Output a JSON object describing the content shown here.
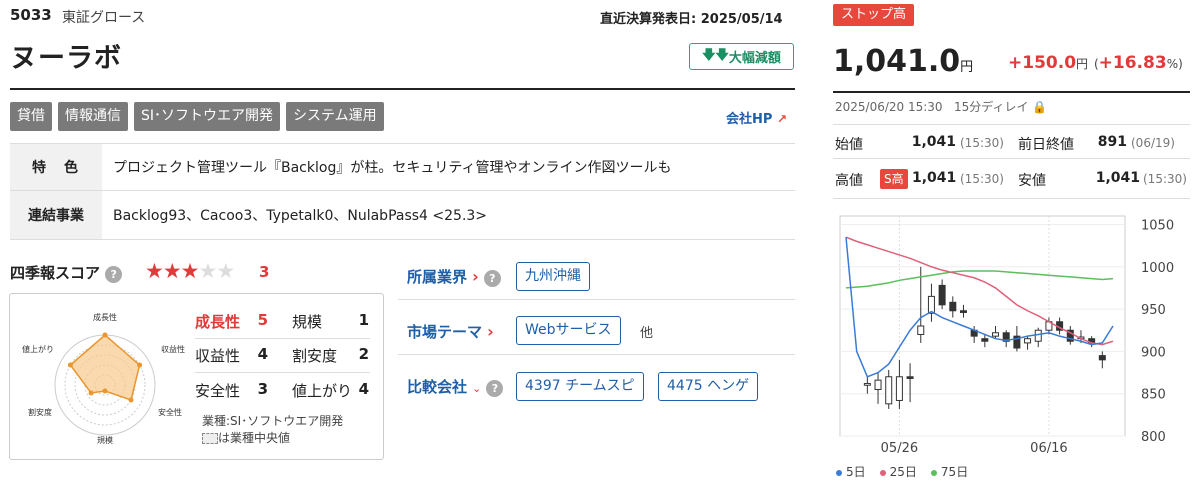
{
  "header": {
    "code": "5033",
    "market": "東証グロース",
    "kessan": "直近決算発表日: 2025/05/14",
    "name": "ヌーラボ",
    "badge": "大幅減額"
  },
  "tags": [
    "貸借",
    "情報通信",
    "SI･ソフトウエア開発",
    "システム運用"
  ],
  "hp_label": "会社HP",
  "feature": {
    "label": "特　色",
    "text": "プロジェクト管理ツール『Backlog』が柱。セキュリティ管理やオンライン作図ツールも"
  },
  "consolidated": {
    "label": "連結事業",
    "text": "Backlog93、Cacoo3、Typetalk0、NulabPass4 <25.3>"
  },
  "score": {
    "title": "四季報スコア",
    "value": "3",
    "stars_filled": 3,
    "stars_total": 5,
    "radar_labels": [
      "成長性",
      "収益性",
      "安全性",
      "規模",
      "割安度",
      "値上がり"
    ],
    "items": [
      {
        "label": "成長性",
        "value": "5",
        "highlight": true
      },
      {
        "label": "規模",
        "value": "1"
      },
      {
        "label": "収益性",
        "value": "4"
      },
      {
        "label": "割安度",
        "value": "2"
      },
      {
        "label": "安全性",
        "value": "3"
      },
      {
        "label": "値上がり",
        "value": "4"
      }
    ],
    "note1": "業種:SI･ソフトウエア開発",
    "note2": "は業種中央値"
  },
  "industry": {
    "label": "所属業界",
    "chip": "九州沖縄",
    "theme_label": "市場テーマ",
    "theme_chip": "Webサービス",
    "theme_more": "他",
    "compare_label": "比較会社",
    "compare_chips": [
      "4397 チームスピ",
      "4475 ヘンゲ"
    ]
  },
  "quote": {
    "stop": "ストップ高",
    "price": "1,041.0",
    "yen": "円",
    "change": "+150.0",
    "change_pct": "+16.83",
    "time": "2025/06/20 15:30",
    "delay": "15分ディレイ",
    "open_label": "始値",
    "open": "1,041",
    "open_time": "(15:30)",
    "prev_label": "前日終値",
    "prev": "891",
    "prev_time": "(06/19)",
    "high_label": "高値",
    "high_badge": "S高",
    "high": "1,041",
    "high_time": "(15:30)",
    "low_label": "安値",
    "low": "1,041",
    "low_time": "(15:30)"
  },
  "colors": {
    "up": "#e03a3a",
    "link": "#1e5fa8",
    "ma5": "#3a7bd5",
    "ma25": "#e0607a",
    "ma75": "#5bbf5b"
  },
  "chart_data": {
    "type": "line",
    "x_ticks": [
      "05/26",
      "06/16"
    ],
    "y_ticks": [
      800,
      850,
      900,
      950,
      1000,
      1050
    ],
    "ylim": [
      800,
      1060
    ],
    "legend": [
      "5日",
      "25日",
      "75日"
    ],
    "ma5": [
      1035,
      900,
      870,
      875,
      885,
      905,
      925,
      940,
      947,
      940,
      935,
      930,
      925,
      920,
      915,
      913,
      915,
      918,
      920,
      922,
      918,
      915,
      912,
      908,
      910,
      930
    ],
    "ma25": [
      1035,
      1030,
      1026,
      1022,
      1018,
      1014,
      1010,
      1005,
      1000,
      996,
      993,
      990,
      987,
      982,
      975,
      965,
      955,
      948,
      942,
      935,
      928,
      922,
      915,
      910,
      908,
      912
    ],
    "ma75": [
      975,
      976,
      977,
      979,
      981,
      984,
      986,
      988,
      990,
      992,
      994,
      995,
      995,
      995,
      995,
      994,
      993,
      992,
      991,
      990,
      989,
      988,
      987,
      986,
      985,
      986
    ],
    "candles": [
      {
        "o": 860,
        "c": 862,
        "h": 870,
        "l": 850
      },
      {
        "o": 855,
        "c": 866,
        "h": 875,
        "l": 838
      },
      {
        "o": 838,
        "c": 870,
        "h": 878,
        "l": 832
      },
      {
        "o": 842,
        "c": 870,
        "h": 890,
        "l": 832
      },
      {
        "o": 870,
        "c": 868,
        "h": 886,
        "l": 840
      },
      {
        "o": 920,
        "c": 930,
        "h": 1000,
        "l": 910
      },
      {
        "o": 945,
        "c": 965,
        "h": 980,
        "l": 935
      },
      {
        "o": 978,
        "c": 955,
        "h": 985,
        "l": 950
      },
      {
        "o": 958,
        "c": 948,
        "h": 965,
        "l": 940
      },
      {
        "o": 948,
        "c": 946,
        "h": 955,
        "l": 940
      },
      {
        "o": 925,
        "c": 918,
        "h": 930,
        "l": 910
      },
      {
        "o": 915,
        "c": 912,
        "h": 920,
        "l": 905
      },
      {
        "o": 918,
        "c": 922,
        "h": 930,
        "l": 915
      },
      {
        "o": 922,
        "c": 912,
        "h": 925,
        "l": 905
      },
      {
        "o": 918,
        "c": 904,
        "h": 930,
        "l": 900
      },
      {
        "o": 910,
        "c": 915,
        "h": 918,
        "l": 902
      },
      {
        "o": 912,
        "c": 925,
        "h": 928,
        "l": 905
      },
      {
        "o": 925,
        "c": 935,
        "h": 940,
        "l": 920
      },
      {
        "o": 935,
        "c": 925,
        "h": 940,
        "l": 920
      },
      {
        "o": 925,
        "c": 912,
        "h": 930,
        "l": 908
      },
      {
        "o": 915,
        "c": 917,
        "h": 925,
        "l": 910
      },
      {
        "o": 915,
        "c": 910,
        "h": 918,
        "l": 905
      },
      {
        "o": 895,
        "c": 890,
        "h": 900,
        "l": 880
      }
    ]
  }
}
